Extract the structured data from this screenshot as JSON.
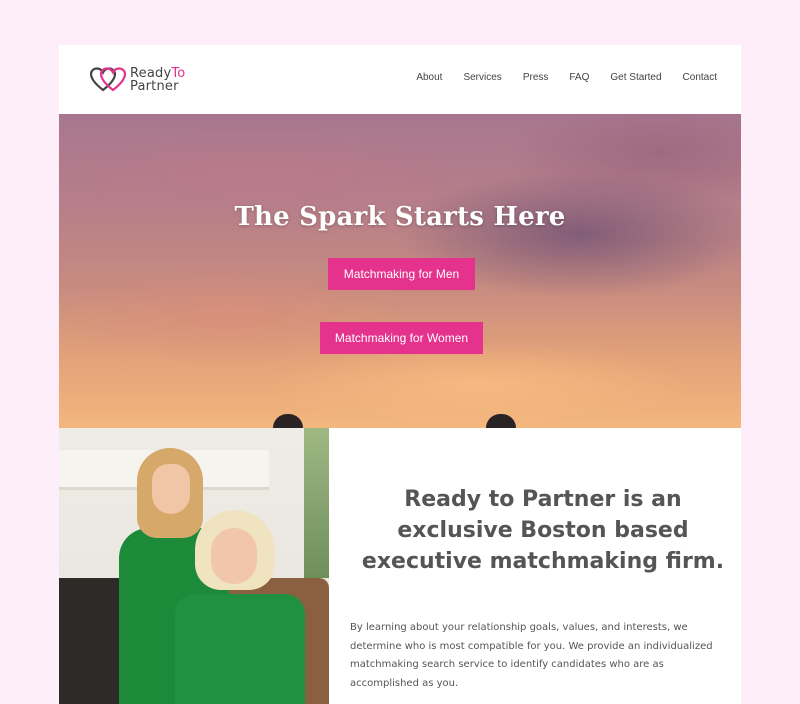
{
  "brand": {
    "logo_line1": "Ready",
    "logo_line1_accent": "To",
    "logo_line2": "Partner",
    "accent_color": "#e5328c"
  },
  "nav": {
    "items": [
      {
        "label": "About"
      },
      {
        "label": "Services"
      },
      {
        "label": "Press"
      },
      {
        "label": "FAQ"
      },
      {
        "label": "Get Started"
      },
      {
        "label": "Contact"
      }
    ]
  },
  "hero": {
    "title": "The Spark Starts Here",
    "button_men": "Matchmaking for Men",
    "button_women": "Matchmaking for Women"
  },
  "about": {
    "headline": "Ready to Partner is an exclusive Boston based executive matchmaking firm.",
    "body": "By learning about your relationship goals, values, and interests, we determine who is most compatible for you. We provide an individualized matchmaking search service to identify candidates who are as accomplished as you."
  },
  "colors": {
    "page_bg": "#fdeefa",
    "button_bg": "#e5328c",
    "text": "#555555"
  }
}
